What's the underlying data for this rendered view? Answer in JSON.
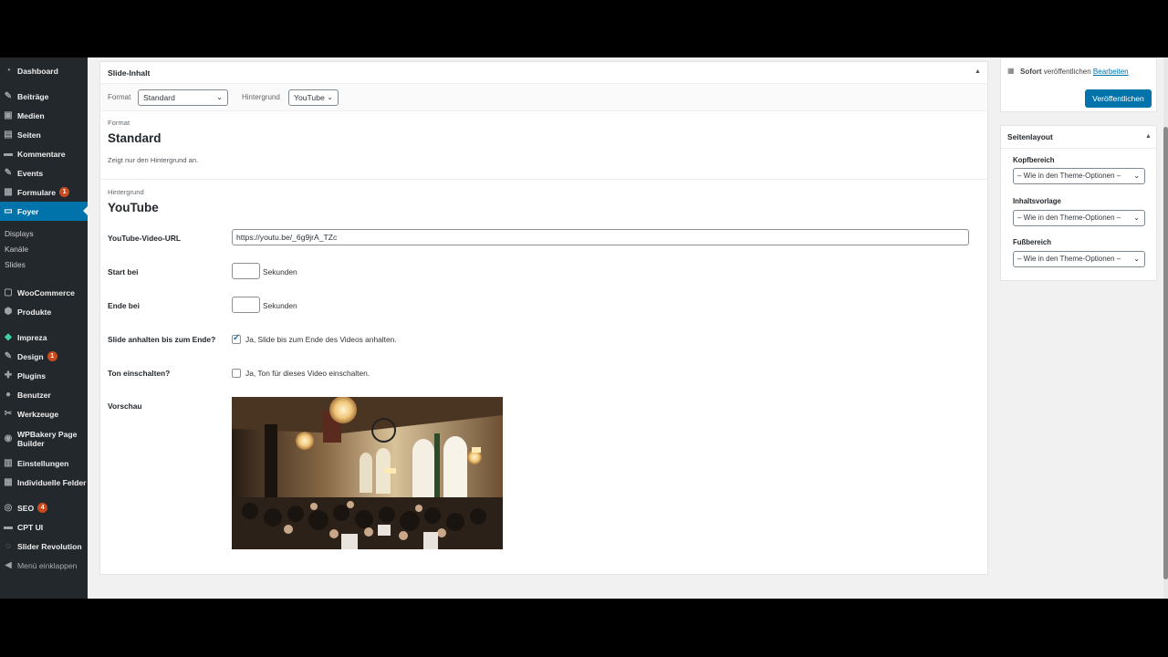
{
  "sidebar": {
    "items": [
      {
        "label": "Dashboard",
        "icon": "dashboard-icon",
        "glyph": "◔"
      },
      {
        "label": "Beiträge",
        "icon": "pin-icon",
        "glyph": "✎"
      },
      {
        "label": "Medien",
        "icon": "media-icon",
        "glyph": "▣"
      },
      {
        "label": "Seiten",
        "icon": "page-icon",
        "glyph": "▤"
      },
      {
        "label": "Kommentare",
        "icon": "comment-icon",
        "glyph": "▬"
      },
      {
        "label": "Events",
        "icon": "pin-icon",
        "glyph": "✎"
      },
      {
        "label": "Formulare",
        "icon": "form-icon",
        "glyph": "▦",
        "badge": "1"
      },
      {
        "label": "Foyer",
        "icon": "monitor-icon",
        "glyph": "▭"
      },
      {
        "label": "WooCommerce",
        "icon": "woo-icon",
        "glyph": "▢"
      },
      {
        "label": "Produkte",
        "icon": "box-icon",
        "glyph": "⬢"
      },
      {
        "label": "Impreza",
        "icon": "gem-icon",
        "glyph": "◆"
      },
      {
        "label": "Design",
        "icon": "brush-icon",
        "glyph": "✎",
        "badge": "1"
      },
      {
        "label": "Plugins",
        "icon": "plugin-icon",
        "glyph": "✚"
      },
      {
        "label": "Benutzer",
        "icon": "user-icon",
        "glyph": "●"
      },
      {
        "label": "Werkzeuge",
        "icon": "wrench-icon",
        "glyph": "✂"
      },
      {
        "label": "WPBakery Page",
        "label2": "Builder",
        "icon": "builder-icon",
        "glyph": "◉"
      },
      {
        "label": "Einstellungen",
        "icon": "settings-icon",
        "glyph": "▥"
      },
      {
        "label": "Individuelle Felder",
        "icon": "fields-icon",
        "glyph": "▦"
      },
      {
        "label": "SEO",
        "icon": "seo-icon",
        "glyph": "◎",
        "badge": "4"
      },
      {
        "label": "CPT UI",
        "icon": "cpt-icon",
        "glyph": "▬"
      },
      {
        "label": "Slider Revolution",
        "icon": "revolution-icon",
        "glyph": "◌"
      },
      {
        "label": "Menü einklappen",
        "icon": "collapse-icon",
        "glyph": "◀"
      }
    ],
    "submenu": [
      "Displays",
      "Kanäle",
      "Slides"
    ]
  },
  "panel": {
    "title": "Slide-Inhalt",
    "format_label": "Format",
    "format_value": "Standard",
    "background_label": "Hintergrund",
    "background_value": "YouTube",
    "format_section_label": "Format",
    "format_section_title": "Standard",
    "format_section_desc": "Zeigt nur den Hintergrund an.",
    "bg_section_label": "Hintergrund",
    "bg_section_title": "YouTube",
    "fields": {
      "url_label": "YouTube-Video-URL",
      "url_value": "https://youtu.be/_6g9jrA_TZc",
      "start_label": "Start bei",
      "start_value": "",
      "start_unit": "Sekunden",
      "end_label": "Ende bei",
      "end_value": "",
      "end_unit": "Sekunden",
      "pause_label": "Slide anhalten bis zum Ende?",
      "pause_checkbox_label": "Ja, Slide bis zum Ende des Videos anhalten.",
      "pause_checked": true,
      "sound_label": "Ton einschalten?",
      "sound_checkbox_label": "Ja, Ton für dieses Video einschalten.",
      "sound_checked": false,
      "preview_label": "Vorschau"
    }
  },
  "publish": {
    "status_strong": "Sofort",
    "status_text": "veröffentlichen",
    "edit_link": "Bearbeiten",
    "button": "Veröffentlichen"
  },
  "layout_box": {
    "title": "Seitenlayout",
    "header_label": "Kopfbereich",
    "header_value": "– Wie in den Theme-Optionen –",
    "content_label": "Inhaltsvorlage",
    "content_value": "– Wie in den Theme-Optionen –",
    "footer_label": "Fußbereich",
    "footer_value": "– Wie in den Theme-Optionen –"
  },
  "colors": {
    "sidebar_bg": "#23282d",
    "active": "#0073aa",
    "badge": "#ca4a1f"
  }
}
